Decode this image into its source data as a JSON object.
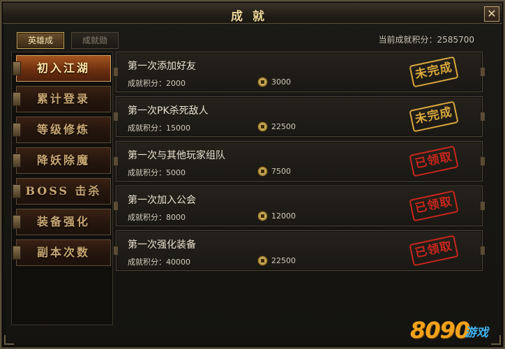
{
  "window": {
    "title": "成就",
    "close_label": "✕"
  },
  "tabs": [
    {
      "label": "英雄成就"
    },
    {
      "label": "成就勋章"
    }
  ],
  "score": {
    "label": "当前成就积分：",
    "value": "2585700"
  },
  "sidebar": {
    "items": [
      {
        "label": "初入江湖",
        "active": true
      },
      {
        "label": "累计登录"
      },
      {
        "label": "等级修炼"
      },
      {
        "label": "降妖除魔"
      },
      {
        "label": "BOSS 击杀"
      },
      {
        "label": "装备强化"
      },
      {
        "label": "副本次数"
      }
    ]
  },
  "achievements": [
    {
      "title": "第一次添加好友",
      "score_label": "成就积分：",
      "score": "2000",
      "reward": "3000",
      "status": "未完成",
      "status_type": "pending"
    },
    {
      "title": "第一次PK杀死敌人",
      "score_label": "成就积分：",
      "score": "15000",
      "reward": "22500",
      "status": "未完成",
      "status_type": "pending"
    },
    {
      "title": "第一次与其他玩家组队",
      "score_label": "成就积分：",
      "score": "5000",
      "reward": "7500",
      "status": "已领取",
      "status_type": "claimed"
    },
    {
      "title": "第一次加入公会",
      "score_label": "成就积分：",
      "score": "8000",
      "reward": "12000",
      "status": "已领取",
      "status_type": "claimed"
    },
    {
      "title": "第一次强化装备",
      "score_label": "成就积分：",
      "score": "40000",
      "reward": "22500",
      "status": "已领取",
      "status_type": "claimed"
    }
  ],
  "colors": {
    "pending": "#d9a73b",
    "claimed": "#c8261c"
  },
  "watermark": {
    "brand": "8090",
    "suffix": "游戏"
  }
}
